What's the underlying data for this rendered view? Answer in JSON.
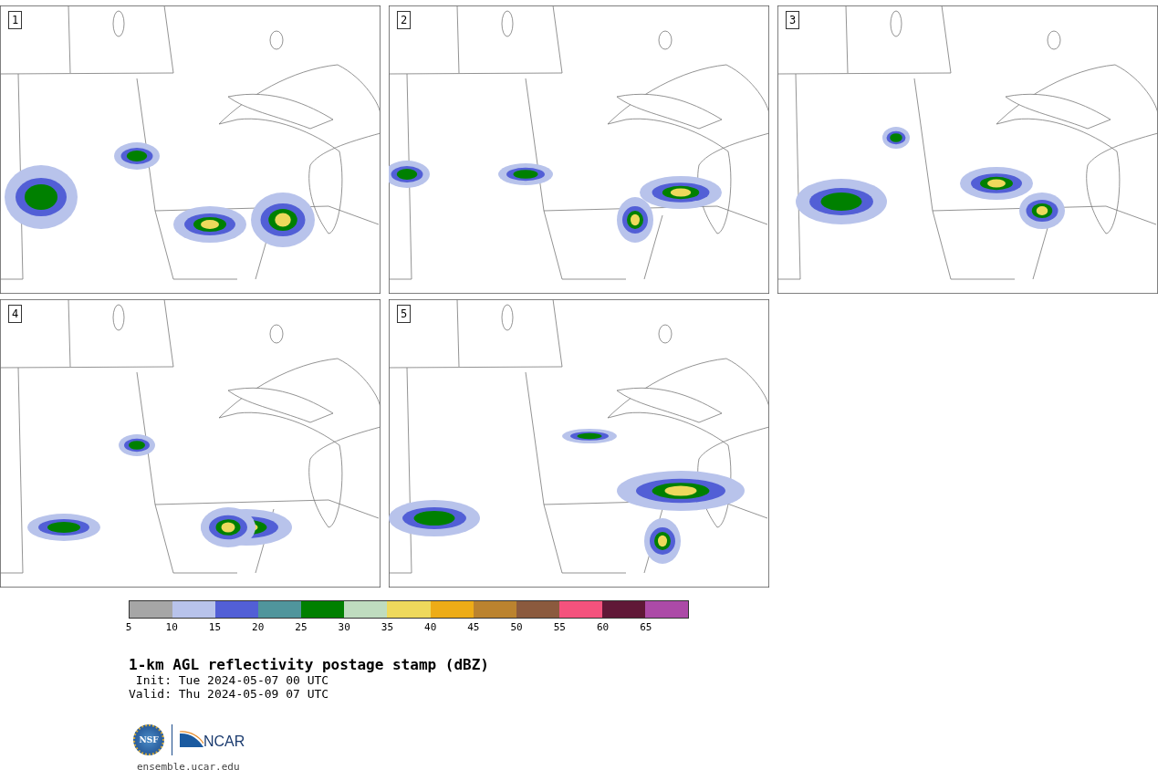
{
  "panels": [
    {
      "label": "1"
    },
    {
      "label": "2"
    },
    {
      "label": "3"
    },
    {
      "label": "4"
    },
    {
      "label": "5"
    }
  ],
  "colorbar": {
    "segments": [
      {
        "color": "#a6a6a6",
        "tick": "5"
      },
      {
        "color": "#b8c3eb",
        "tick": "10"
      },
      {
        "color": "#525fd6",
        "tick": "15"
      },
      {
        "color": "#50959c",
        "tick": "20"
      },
      {
        "color": "#008000",
        "tick": "25"
      },
      {
        "color": "#bfdcbf",
        "tick": "30"
      },
      {
        "color": "#eed95c",
        "tick": "35"
      },
      {
        "color": "#edac17",
        "tick": "40"
      },
      {
        "color": "#bb832f",
        "tick": "45"
      },
      {
        "color": "#8b5a3e",
        "tick": "50"
      },
      {
        "color": "#f4527d",
        "tick": "55"
      },
      {
        "color": "#601837",
        "tick": "60"
      },
      {
        "color": "#ac4aa7",
        "tick": "65"
      }
    ]
  },
  "title": "1-km AGL reflectivity postage stamp (dBZ)",
  "init": " Init: Tue 2024-05-07 00 UTC",
  "valid": "Valid: Thu 2024-05-09 07 UTC",
  "logos": {
    "nsf": "NSF",
    "ncar": "NCAR"
  },
  "footer": "ensemble.ucar.edu"
}
